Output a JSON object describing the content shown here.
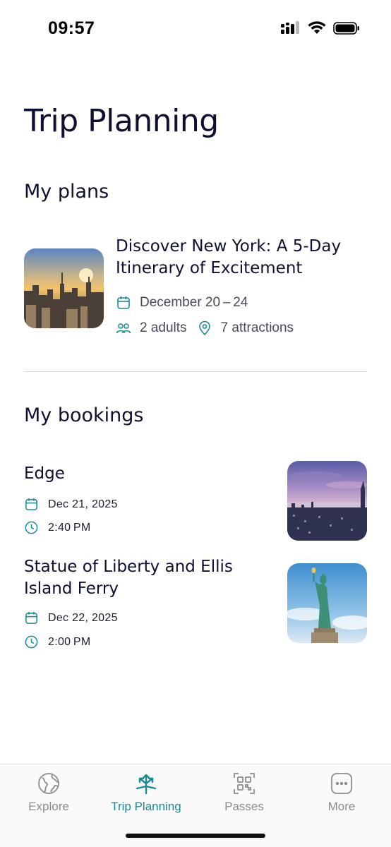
{
  "status_bar": {
    "time": "09:57"
  },
  "page": {
    "title": "Trip Planning"
  },
  "my_plans": {
    "heading": "My plans",
    "plan": {
      "title": "Discover New York: A 5-Day Itinerary of Excitement",
      "dates": "December 20 – 24",
      "adults": "2 adults",
      "attractions": "7 attractions"
    }
  },
  "my_bookings": {
    "heading": "My bookings",
    "items": [
      {
        "title": "Edge",
        "date": "Dec 21, 2025",
        "time": "2:40 PM"
      },
      {
        "title": "Statue of Liberty and Ellis Island Ferry",
        "date": "Dec 22, 2025",
        "time": "2:00 PM"
      }
    ]
  },
  "tab_bar": {
    "tabs": [
      {
        "label": "Explore",
        "icon": "globe-icon"
      },
      {
        "label": "Trip Planning",
        "icon": "directions-icon",
        "active": true
      },
      {
        "label": "Passes",
        "icon": "qr-code-icon"
      },
      {
        "label": "More",
        "icon": "more-dots-icon"
      }
    ]
  },
  "colors": {
    "accent": "#1c8a93",
    "text": "#0f1030",
    "muted": "#8b8b92"
  }
}
